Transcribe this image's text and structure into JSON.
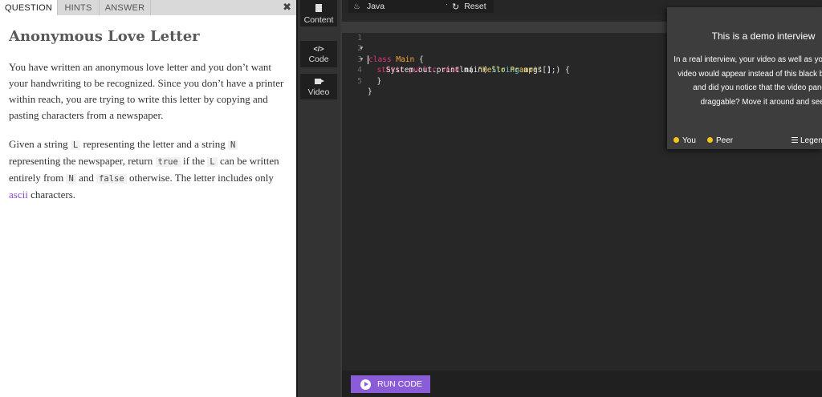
{
  "question_panel": {
    "tabs": [
      {
        "label": "QUESTION",
        "active": true
      },
      {
        "label": "HINTS",
        "active": false
      },
      {
        "label": "ANSWER",
        "active": false
      }
    ],
    "close_label": "✖",
    "title": "Anonymous Love Letter",
    "paragraph1": "You have written an anonymous love letter and you don’t want your handwriting to be recognized. Since you don’t have a printer within reach, you are trying to write this letter by copying and pasting characters from a newspaper.",
    "paragraph2": {
      "t1": "Given a string ",
      "c1": "L",
      "t2": " representing the letter and a string ",
      "c2": "N",
      "t3": " representing the newspaper, return ",
      "c3": "true",
      "t4": " if the ",
      "c4": "L",
      "t5": " can be written entirely from ",
      "c5": "N",
      "t6": " and ",
      "c6": "false",
      "t7": " otherwise. The letter includes only ",
      "link": "ascii",
      "t8": " characters."
    }
  },
  "side_nav": {
    "content_label": "Content",
    "code_label": "Code",
    "code_icon": "</>",
    "video_label": "Video"
  },
  "toolbar": {
    "language": "Java",
    "reset_label": "Reset"
  },
  "code": {
    "line_numbers": [
      "1",
      "2",
      "3",
      "4",
      "5"
    ],
    "l1": {
      "kw": "class",
      "cls": "Main",
      "rest": " {"
    },
    "l2": {
      "indent": "  ",
      "kw": "static public void",
      "name": " main( ",
      "typ": "String",
      "rest": " args[] ) {"
    },
    "l3": {
      "indent": "    ",
      "call": "System.out.println( ",
      "str": "\"Hello Pramp!\"",
      "rest": " );"
    },
    "l4": {
      "text": "  }"
    },
    "l5": {
      "text": "}"
    }
  },
  "run": {
    "label": "RUN CODE"
  },
  "video": {
    "title": "This is a demo interview",
    "body": "In a real interview, your video as well as your peer's video would appear instead of this black box. Oh, and did you notice that the video pane is draggable? Move it around and see!",
    "you_label": "You",
    "peer_label": "Peer",
    "legend_label": "Legend",
    "dot_color": "#f5c518"
  },
  "colors": {
    "accent": "#8a5cd8",
    "link": "#8b4bd6"
  }
}
